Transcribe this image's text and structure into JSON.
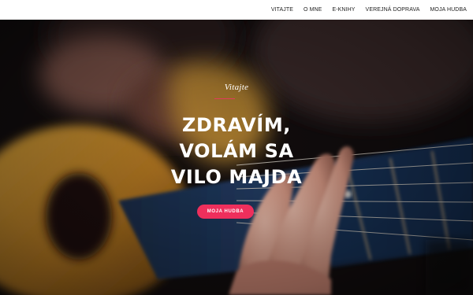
{
  "nav": {
    "items": [
      {
        "label": "VITAJTE"
      },
      {
        "label": "O MNE"
      },
      {
        "label": "E-KNIHY"
      },
      {
        "label": "VEREJNÁ DOPRAVA"
      },
      {
        "label": "MOJA HUDBA"
      }
    ]
  },
  "hero": {
    "kicker": "Vitajte",
    "title_lines": [
      "ZDRAVÍM,",
      "VOLÁM SA",
      "VILO MAJDA"
    ],
    "button_label": "MOJA HUDBA",
    "image_subject": "guitar-player-photo"
  },
  "colors": {
    "accent": "#ee2f5c",
    "divider": "#e23b5b",
    "nav_text": "#222222",
    "hero_text": "#ffffff"
  }
}
